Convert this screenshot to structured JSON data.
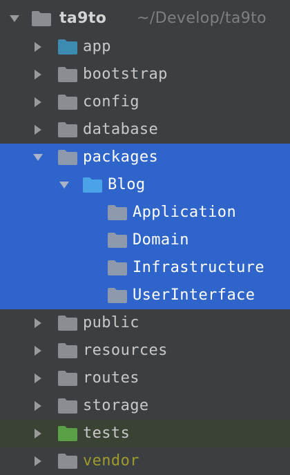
{
  "project": {
    "name": "ta9to",
    "path": "~/Develop/ta9to"
  },
  "tree": [
    {
      "label": "app",
      "expanded": false,
      "icon": "folder-source-icon"
    },
    {
      "label": "bootstrap",
      "expanded": false,
      "icon": "folder-icon"
    },
    {
      "label": "config",
      "expanded": false,
      "icon": "folder-icon"
    },
    {
      "label": "database",
      "expanded": false,
      "icon": "folder-icon"
    },
    {
      "label": "packages",
      "expanded": true,
      "selected": true,
      "icon": "folder-icon",
      "children": [
        {
          "label": "Blog",
          "expanded": true,
          "selected": true,
          "icon": "folder-package-icon",
          "children": [
            {
              "label": "Application",
              "icon": "folder-icon",
              "selected": true
            },
            {
              "label": "Domain",
              "icon": "folder-icon",
              "selected": true
            },
            {
              "label": "Infrastructure",
              "icon": "folder-icon",
              "selected": true
            },
            {
              "label": "UserInterface",
              "icon": "folder-icon",
              "selected": true
            }
          ]
        }
      ]
    },
    {
      "label": "public",
      "expanded": false,
      "icon": "folder-icon"
    },
    {
      "label": "resources",
      "expanded": false,
      "icon": "folder-icon"
    },
    {
      "label": "routes",
      "expanded": false,
      "icon": "folder-icon"
    },
    {
      "label": "storage",
      "expanded": false,
      "icon": "folder-icon"
    },
    {
      "label": "tests",
      "expanded": false,
      "icon": "folder-test-icon"
    },
    {
      "label": "vendor",
      "expanded": false,
      "icon": "folder-icon",
      "excluded": true
    }
  ],
  "colors": {
    "background": "#3c3f41",
    "selection": "#2f65ca",
    "folder_gray": "#8a8e92",
    "folder_source": "#3d8bb0",
    "folder_package": "#4aa3e8",
    "folder_test": "#5aa046",
    "vendor_text": "#9e9a2c",
    "path_text": "#7f7f7f"
  }
}
